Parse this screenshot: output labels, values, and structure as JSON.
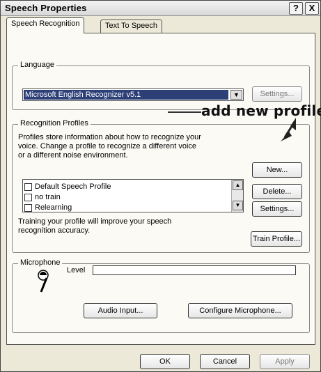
{
  "window": {
    "title": "Speech Properties",
    "help_glyph": "?",
    "close_glyph": "X"
  },
  "tabs": [
    {
      "label": "Speech Recognition",
      "active": true
    },
    {
      "label": "Text To Speech",
      "active": false
    }
  ],
  "language": {
    "group_label": "Language",
    "selected_engine": "Microsoft English Recognizer v5.1",
    "settings_button": "Settings..."
  },
  "profiles": {
    "group_label": "Recognition Profiles",
    "description": [
      "Profiles store information about how to recognize your",
      "voice. Change a profile to recognize a different voice",
      "or a different noise environment."
    ],
    "items": [
      {
        "label": "Default Speech Profile",
        "checked": false
      },
      {
        "label": "no train",
        "checked": false
      },
      {
        "label": "Relearning",
        "checked": false
      }
    ],
    "new_button": "New...",
    "delete_button": "Delete...",
    "settings_button": "Settings...",
    "training_text": [
      "Training your profile will improve your speech",
      "recognition accuracy."
    ],
    "train_button": "Train Profile..."
  },
  "annotation": {
    "text": "add new profile"
  },
  "microphone": {
    "group_label": "Microphone",
    "level_label": "Level",
    "level_value": 0,
    "audio_input_button": "Audio Input...",
    "configure_button": "Configure Microphone..."
  },
  "footer": {
    "ok_button": "OK",
    "cancel_button": "Cancel",
    "apply_button": "Apply"
  },
  "colors": {
    "selection": "#2d3f77",
    "panel": "#fbfaf5",
    "dialog": "#ece9d8"
  },
  "icons": {
    "arrow": "arrow-down-right-icon",
    "microphone": "microphone-icon"
  }
}
